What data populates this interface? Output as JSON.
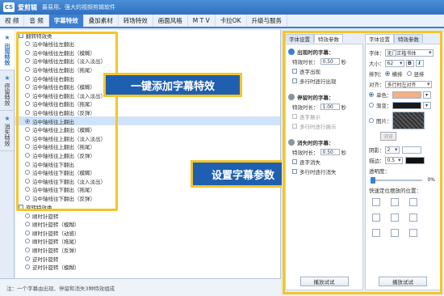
{
  "app": {
    "logo": "CS",
    "name": "爱剪辑",
    "slogan": "最易用、强大的视频剪辑软件"
  },
  "menu": [
    "视 频",
    "音 频",
    "字幕特效",
    "叠加素材",
    "转场特效",
    "画面风格",
    "M T V",
    "卡拉OK",
    "升级与服务"
  ],
  "vtabs": [
    "出现特效",
    "停留特效",
    "消失特效"
  ],
  "category_1": "翻转特效类",
  "effects_1": [
    "沿中轴线往左翻出",
    "沿中轴线往左翻出（模糊）",
    "沿中轴线往左翻出（淡入淡出）",
    "沿中轴线往左翻出（拖尾）",
    "沿中轴线往右翻出",
    "沿中轴线往右翻出（模糊）",
    "沿中轴线往右翻出（淡入淡出）",
    "沿中轴线往右翻出（拖尾）",
    "沿中轴线往右翻出（反弹）",
    "沿中轴线往上翻出",
    "沿中轴线往上翻出（模糊）",
    "沿中轴线往上翻出（淡入淡出）",
    "沿中轴线往上翻出（拖尾）",
    "沿中轴线往上翻出（反弹）",
    "沿中轴线往下翻出",
    "沿中轴线往下翻出（模糊）",
    "沿中轴线往下翻出（淡入淡出）",
    "沿中轴线往下翻出（拖尾）",
    "沿中轴线往下翻出（反弹）"
  ],
  "selected_effect_index": 9,
  "category_2": "旋转特效类",
  "effects_2": [
    "顺时针旋转",
    "顺时针旋转（模糊）",
    "顺时针旋转（动感）",
    "顺时针旋转（拖尾）",
    "顺时针旋转（反弹）",
    "逆时针旋转",
    "逆时针旋转（模糊）"
  ],
  "callout_left": "一键添加字幕特效",
  "callout_right": "设置字幕参数",
  "status": "注：一个字幕由出现、停留和消失3种特效组成",
  "right_tabs": {
    "left": [
      "字体设置",
      "特效参数"
    ],
    "right": [
      "字体设置",
      "特效参数"
    ]
  },
  "effect_params": {
    "appear": {
      "title": "出现时的字幕：",
      "duration_label": "特效时长：",
      "duration": "0.50",
      "unit": "秒",
      "opt1": "逐字出现",
      "opt2": "多行时逐行出现"
    },
    "stay": {
      "title": "停留时的字幕：",
      "duration_label": "特效时长：",
      "duration": "1.00",
      "unit": "秒",
      "opt1": "逐字展示",
      "opt2": "多行时逐行展示"
    },
    "vanish": {
      "title": "消失时的字幕：",
      "duration_label": "特效时长：",
      "duration": "0.50",
      "unit": "秒",
      "opt1": "逐字消失",
      "opt2": "多行时逐行消失"
    },
    "apply": "播放试试"
  },
  "font_settings": {
    "font_label": "字体：",
    "font_value": "无门正楷书体",
    "size_label": "大小：",
    "size_value": "62",
    "bold": "B",
    "italic": "I",
    "layout_label": "排列：",
    "horizontal": "横排",
    "vertical": "竖排",
    "align_label": "对齐：",
    "align_value": "多行时左对齐",
    "color_single": "单色：",
    "color_gradient": "渐变：",
    "color_image": "图片：",
    "browse": "浏览",
    "shadow_label": "阴影：",
    "shadow_value": "2",
    "stroke_label": "描边：",
    "stroke_value": "0.5",
    "opacity_label": "透明度：",
    "opacity_value": "0%",
    "quickpos_label": "快速定位摆放的位置：",
    "apply": "播放试试",
    "single_color": "#f4b183"
  }
}
